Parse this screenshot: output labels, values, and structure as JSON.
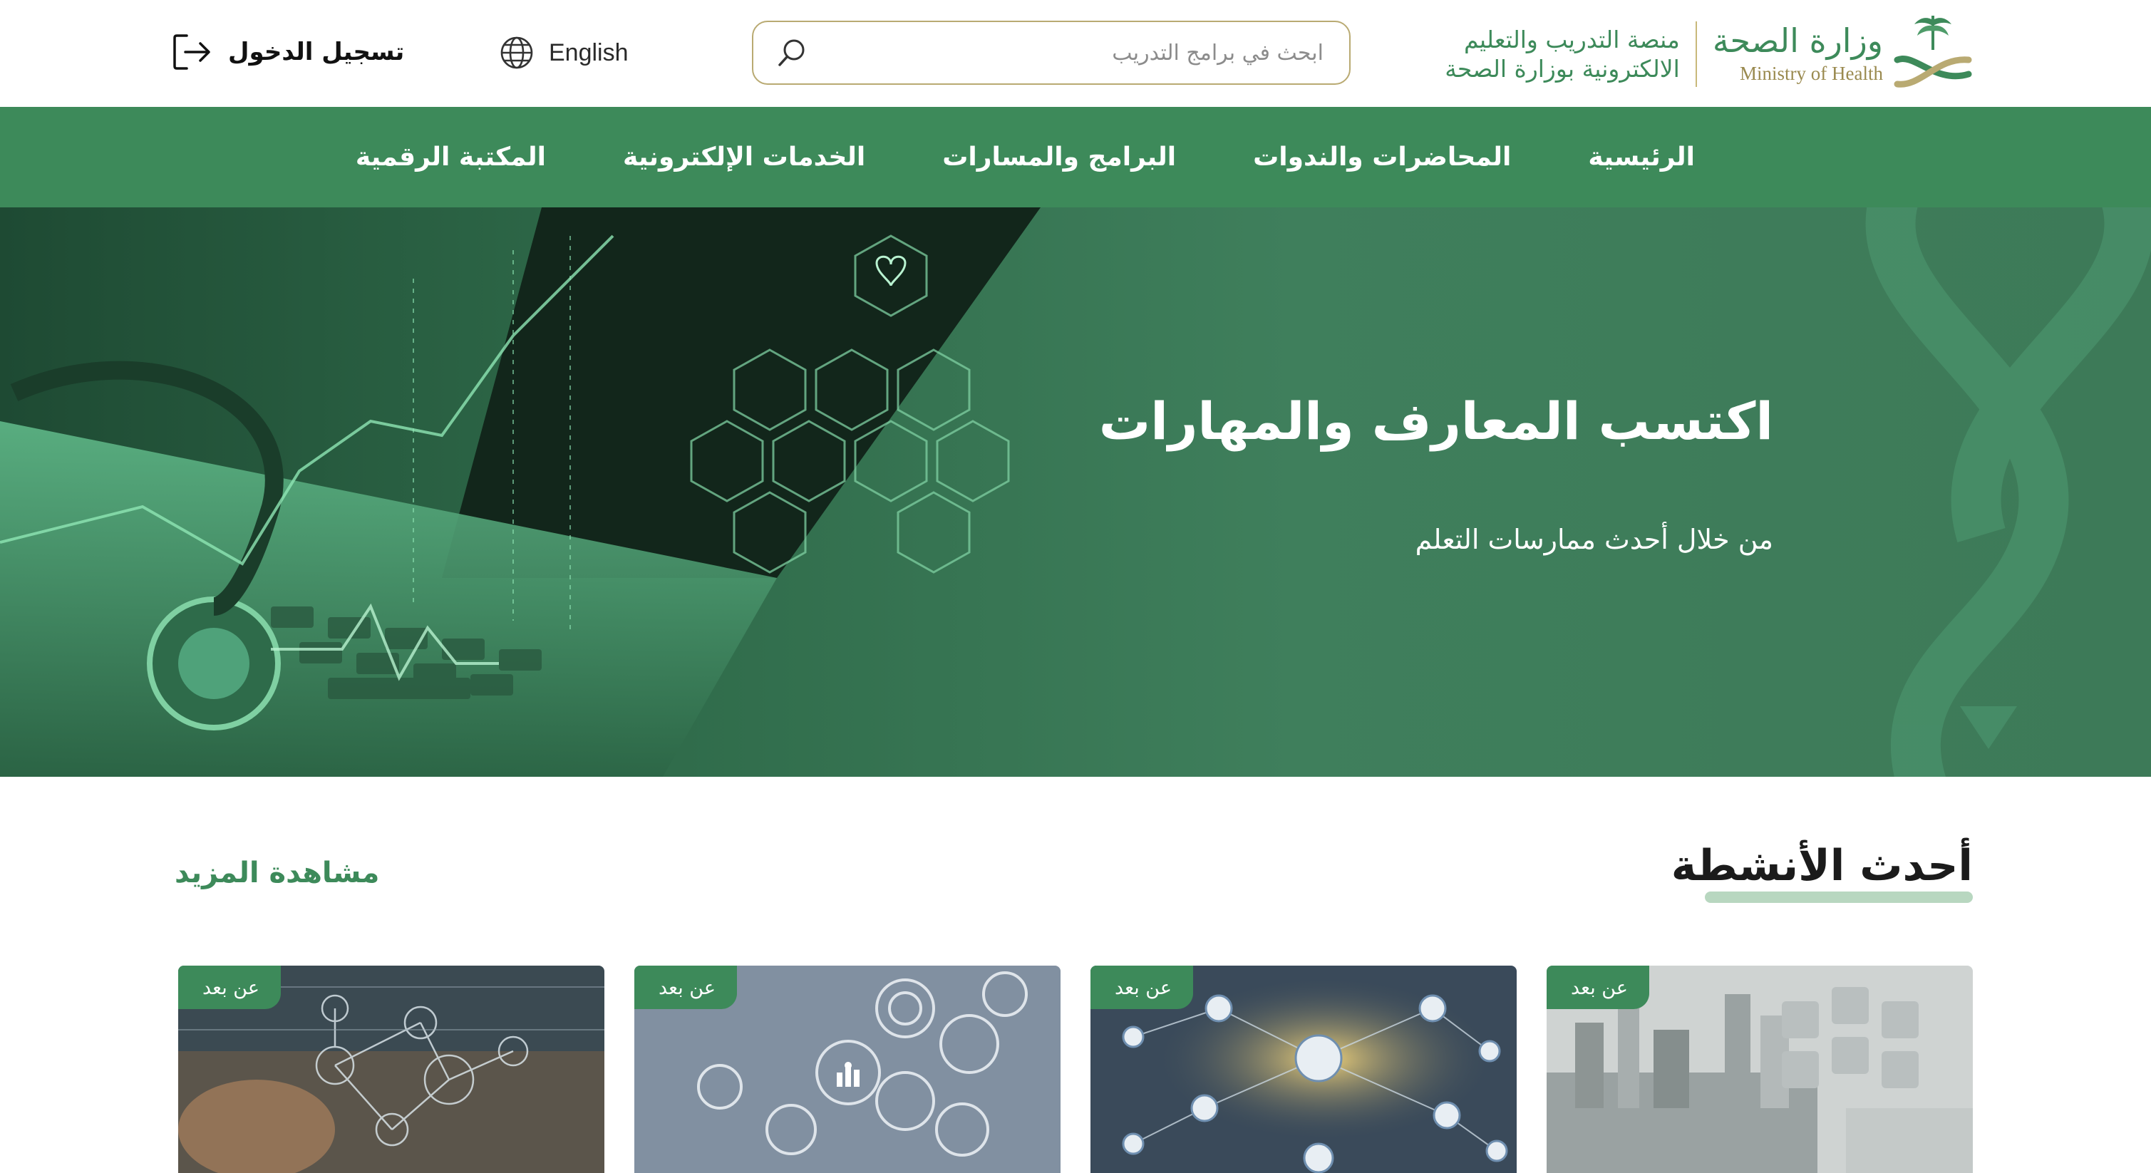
{
  "header": {
    "logo": {
      "ministry_ar": "وزارة الصحة",
      "ministry_en": "Ministry of Health",
      "platform_line1": "منصة التدريب والتعليم",
      "platform_line2": "الالكترونية بوزارة الصحة"
    },
    "search": {
      "placeholder": "ابحث في برامج التدريب",
      "value": ""
    },
    "language_label": "English",
    "login_label": "تسجيل الدخول"
  },
  "nav": {
    "items": [
      {
        "label": "الرئيسية"
      },
      {
        "label": "المحاضرات والندوات"
      },
      {
        "label": "البرامج والمسارات"
      },
      {
        "label": "الخدمات الإلكترونية"
      },
      {
        "label": "المكتبة الرقمية"
      }
    ]
  },
  "hero": {
    "title": "اكتسب المعارف والمهارات",
    "subtitle": "من خلال أحدث ممارسات التعلم"
  },
  "activities": {
    "title": "أحدث الأنشطة",
    "see_more": "مشاهدة المزيد",
    "cards": [
      {
        "badge": "عن بعد"
      },
      {
        "badge": "عن بعد"
      },
      {
        "badge": "عن بعد"
      },
      {
        "badge": "عن بعد"
      }
    ]
  },
  "colors": {
    "brand_green": "#3d8a5a",
    "hero_green": "#3f7f5c",
    "gold": "#b9aa72"
  }
}
